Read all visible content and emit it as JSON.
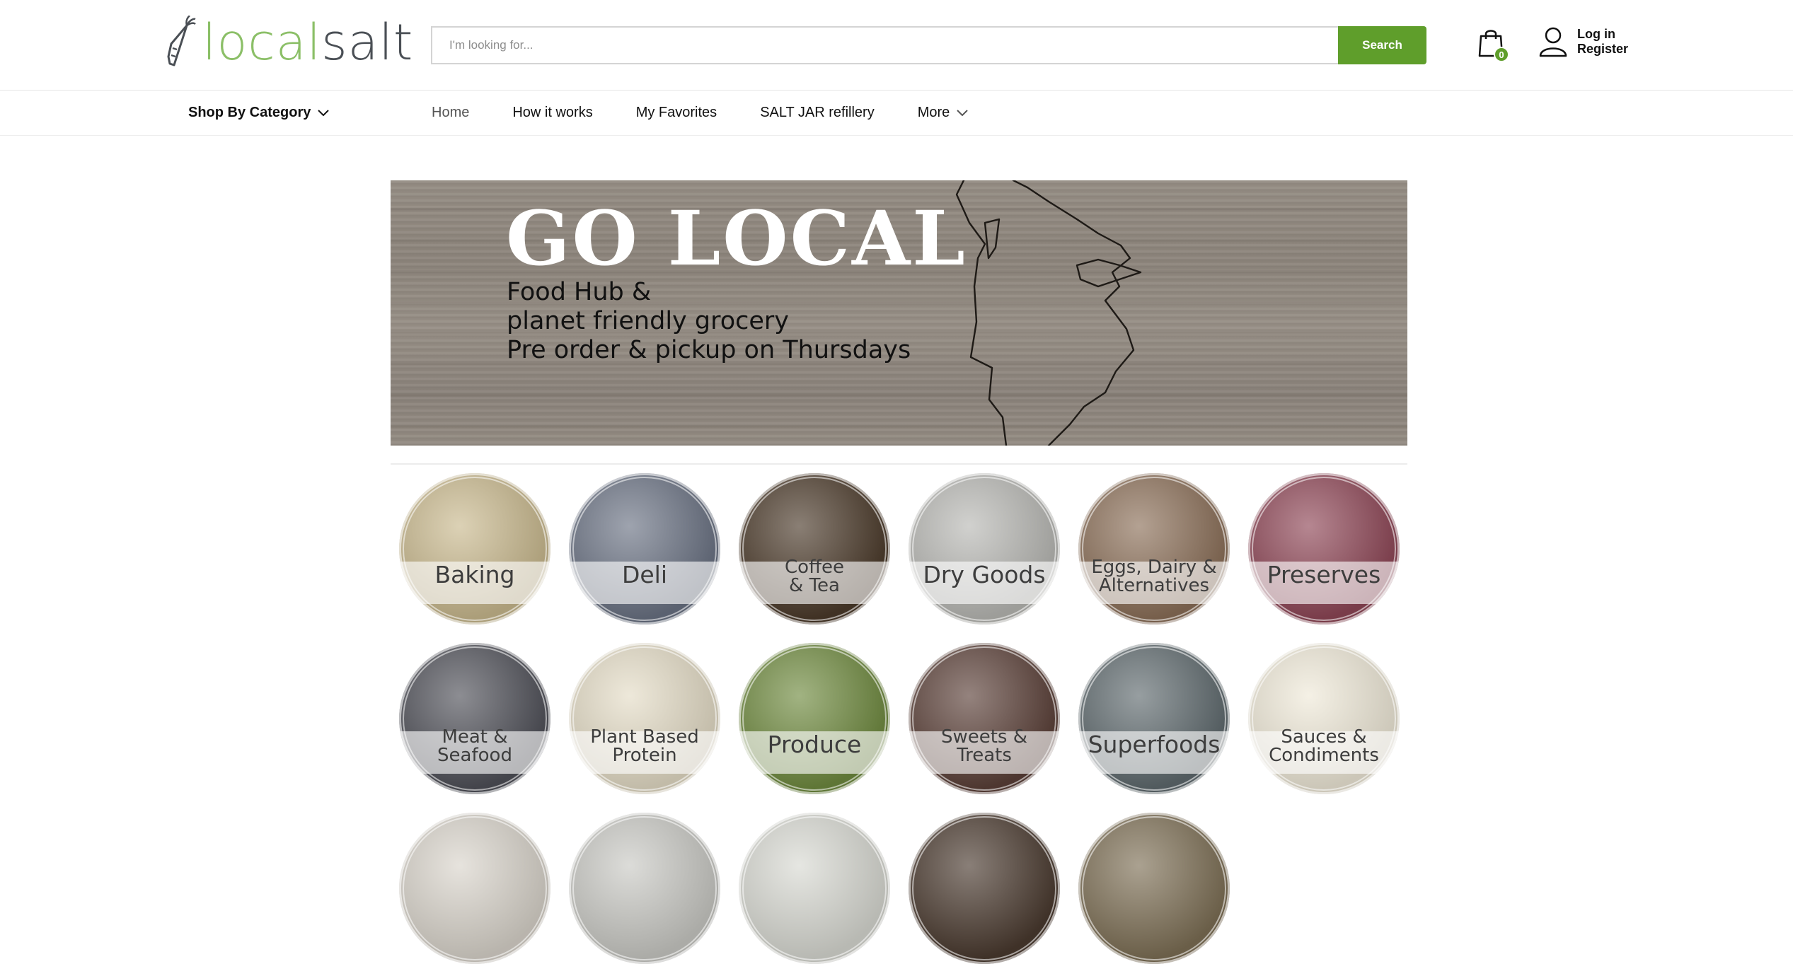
{
  "header": {
    "logo": {
      "part1": "local",
      "part2": "salt"
    },
    "search": {
      "placeholder": "I'm looking for...",
      "button_label": "Search"
    },
    "cart": {
      "count": "0"
    },
    "account": {
      "login_label": "Log in",
      "register_label": "Register"
    }
  },
  "nav": {
    "shop_by_category": "Shop By Category",
    "links": [
      {
        "label": "Home"
      },
      {
        "label": "How it works"
      },
      {
        "label": "My Favorites"
      },
      {
        "label": "SALT JAR refillery"
      },
      {
        "label": "More"
      }
    ]
  },
  "banner": {
    "title": "GO LOCAL",
    "line1": "Food Hub &",
    "line2": "planet friendly grocery",
    "line3": "Pre order & pickup on Thursdays"
  },
  "categories": [
    {
      "label": "Baking",
      "color": "#c9b98e"
    },
    {
      "label": "Deli",
      "color": "#6a7283"
    },
    {
      "label": "Coffee\n& Tea",
      "color": "#4b3a2a"
    },
    {
      "label": "Dry Goods",
      "color": "#b8b8b4"
    },
    {
      "label": "Eggs, Dairy &\nAlternatives",
      "color": "#8b6f58"
    },
    {
      "label": "Preserves",
      "color": "#8e4656"
    },
    {
      "label": "Meat &\nSeafood",
      "color": "#4f5058"
    },
    {
      "label": "Plant Based\nProtein",
      "color": "#e4dcc6"
    },
    {
      "label": "Produce",
      "color": "#6f8a3f"
    },
    {
      "label": "Sweets &\nTreats",
      "color": "#5b4038"
    },
    {
      "label": "Superfoods",
      "color": "#5f6a6e"
    },
    {
      "label": "Sauces &\nCondiments",
      "color": "#efe9d8"
    },
    {
      "label": "",
      "color": "#d9d4cb"
    },
    {
      "label": "",
      "color": "#c9c9c4"
    },
    {
      "label": "",
      "color": "#d8d9d2"
    },
    {
      "label": "",
      "color": "#4a3a2f"
    },
    {
      "label": "",
      "color": "#7d6f55"
    }
  ]
}
